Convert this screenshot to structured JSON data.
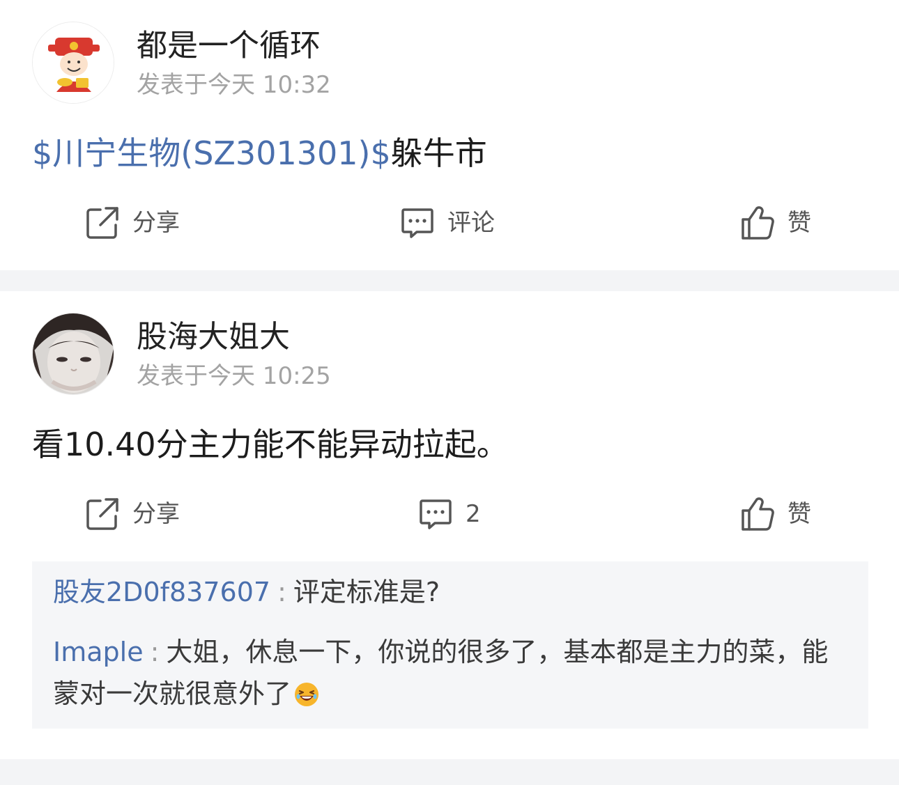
{
  "posts": [
    {
      "username": "都是一个循环",
      "timestamp": "发表于今天 10:32",
      "stock_link": "$川宁生物(SZ301301)$",
      "text": "躲牛市",
      "actions": {
        "share": "分享",
        "comment": "评论",
        "like": "赞"
      },
      "avatar_icon": "fortune-god-avatar"
    },
    {
      "username": "股海大姐大",
      "timestamp": "发表于今天 10:25",
      "text": "看10.40分主力能不能异动拉起。",
      "actions": {
        "share": "分享",
        "comment": "2",
        "like": "赞"
      },
      "avatar_icon": "woman-photo-avatar",
      "replies": [
        {
          "author": "股友2D0f837607",
          "separator": ":",
          "text": "评定标准是?"
        },
        {
          "author": "Imaple",
          "separator": ":",
          "text": "大姐，休息一下，你说的很多了，基本都是主力的菜，能蒙对一次就很意外了",
          "emoji": "laughing-emoji"
        }
      ]
    }
  ],
  "colors": {
    "link": "#4a6fad",
    "separator_bg": "#f3f4f6",
    "reply_bg": "#f5f6f8",
    "muted_text": "#a3a3a3"
  }
}
